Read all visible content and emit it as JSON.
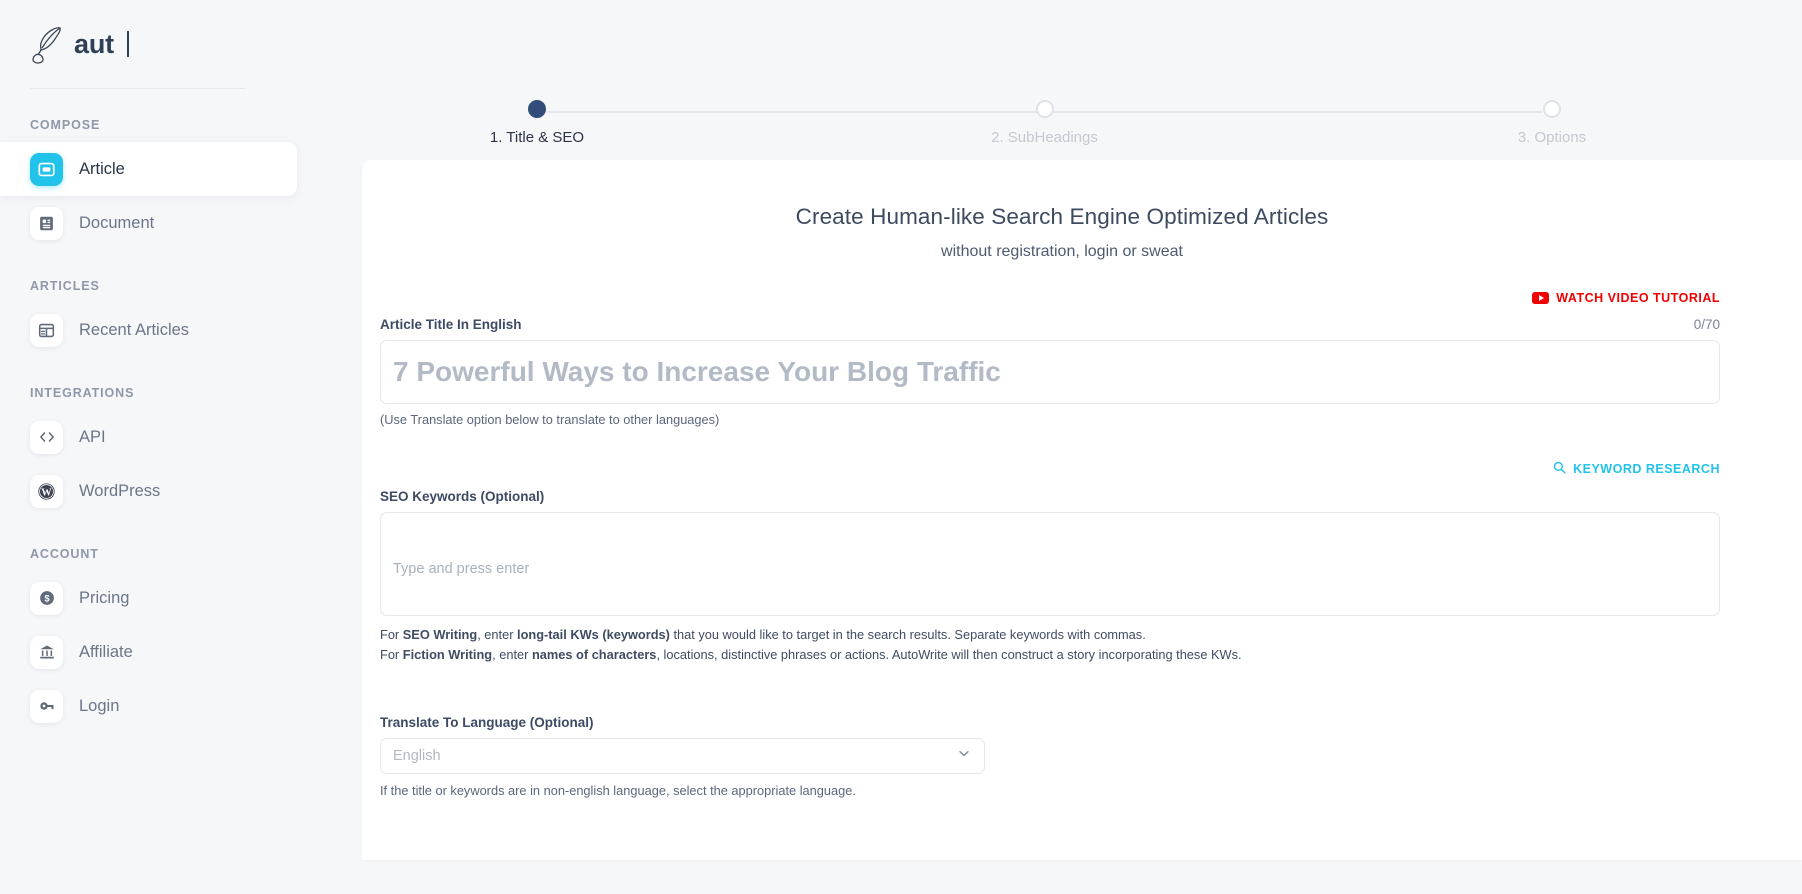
{
  "brand": {
    "name": "aut",
    "logo_icon": "quill-pen-icon"
  },
  "sidebar": {
    "sections": [
      {
        "label": "COMPOSE",
        "items": [
          {
            "label": "Article",
            "icon": "article-window-icon",
            "active": true
          },
          {
            "label": "Document",
            "icon": "document-lines-icon",
            "active": false
          }
        ]
      },
      {
        "label": "ARTICLES",
        "items": [
          {
            "label": "Recent Articles",
            "icon": "layout-grid-icon",
            "active": false
          }
        ]
      },
      {
        "label": "INTEGRATIONS",
        "items": [
          {
            "label": "API",
            "icon": "code-brackets-icon",
            "active": false
          },
          {
            "label": "WordPress",
            "icon": "wordpress-icon",
            "active": false
          }
        ]
      },
      {
        "label": "ACCOUNT",
        "items": [
          {
            "label": "Pricing",
            "icon": "dollar-circle-icon",
            "active": false
          },
          {
            "label": "Affiliate",
            "icon": "bank-building-icon",
            "active": false
          },
          {
            "label": "Login",
            "icon": "key-icon",
            "active": false
          }
        ]
      }
    ]
  },
  "stepper": {
    "steps": [
      {
        "label": "1. Title & SEO",
        "state": "active"
      },
      {
        "label": "2. SubHeadings",
        "state": "upcoming"
      },
      {
        "label": "3. Options",
        "state": "upcoming"
      }
    ]
  },
  "main": {
    "title": "Create Human-like Search Engine Optimized Articles",
    "subtitle": "without registration, login or sweat",
    "video_tutorial_label": "Watch Video Tutorial",
    "keyword_research_label": "Keyword Research",
    "article_title": {
      "label": "Article Title In English",
      "counter": "0/70",
      "value": "",
      "placeholder": "7 Powerful Ways to Increase Your Blog Traffic",
      "hint": "(Use Translate option below to translate to other languages)"
    },
    "seo_keywords": {
      "label": "SEO Keywords (Optional)",
      "value": "",
      "placeholder": "Type and press enter",
      "help_line1": {
        "p1": "For ",
        "b1": "SEO Writing",
        "p2": ", enter ",
        "b2": "long-tail KWs (keywords)",
        "p3": " that you would like to target in the search results. Separate keywords with commas."
      },
      "help_line2": {
        "p1": "For ",
        "b1": "Fiction Writing",
        "p2": ", enter ",
        "b2": "names of characters",
        "p3": ", locations, distinctive phrases or actions. AutoWrite will then construct a story incorporating these KWs."
      }
    },
    "translate": {
      "label": "Translate To Language (Optional)",
      "selected": "English",
      "hint": "If the title or keywords are in non-english language, select the appropriate language."
    }
  },
  "colors": {
    "accent": "#21c3ea",
    "step_active": "#334d7a",
    "video_red": "#f00000",
    "page_bg": "#f6f7f9"
  }
}
